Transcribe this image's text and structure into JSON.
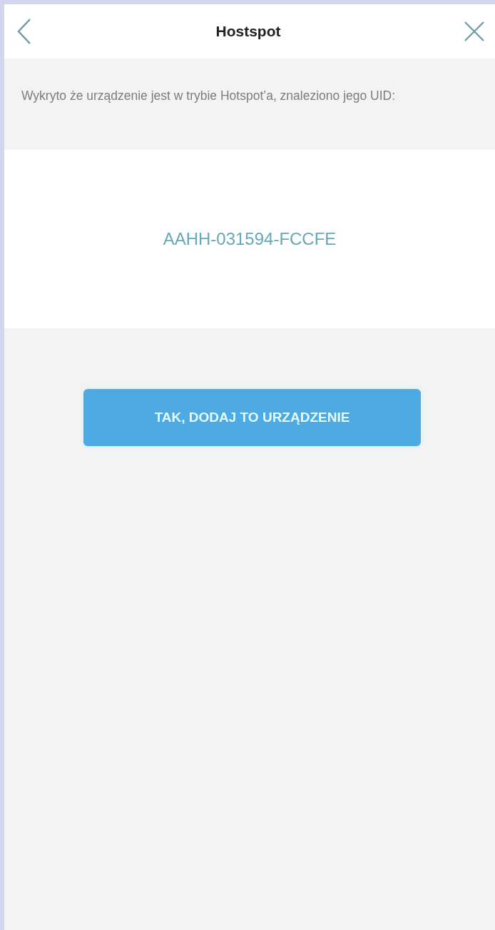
{
  "header": {
    "title": "Hostspot"
  },
  "message": "Wykryto że urządzenie jest w trybie Hotspot’a, znaleziono jego UID:",
  "uid": "AAHH-031594-FCCFE",
  "buttons": [
    {
      "label": "TAK, DODAJ TO URZĄDZENIE",
      "kind": "primary"
    }
  ]
}
